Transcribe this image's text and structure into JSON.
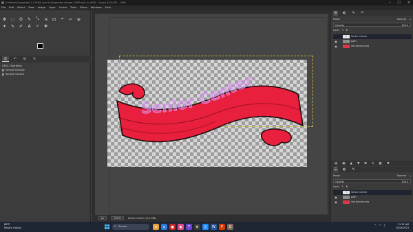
{
  "window": {
    "title": "[Untitled]-(imported)-1.0 (RGB color 8-bit gamma integer, GIMP built-in sRGB, 1 layer) 447x255 – GIMP",
    "minimize": "–",
    "maximize": "☐",
    "close": "✕"
  },
  "menu": [
    "File",
    "Edit",
    "Select",
    "View",
    "Image",
    "Layer",
    "Colors",
    "Tools",
    "Filters",
    "Windows",
    "Help"
  ],
  "toolbox": {
    "tools": [
      "✥",
      "⬚",
      "ʘ",
      "✎",
      "⤡",
      "⇲",
      "⊡",
      "⌖",
      "✂",
      "⊕",
      "✦",
      "✎",
      "✐",
      "A",
      "⌕",
      "✚"
    ],
    "tabs": [
      "☰",
      "↶",
      "⛁",
      "✎"
    ],
    "options_title": "GEGL Operation",
    "sample_average": "Sample average",
    "sample_merged": "Sample merged"
  },
  "canvas": {
    "banner_text": "Senior Center",
    "banner_color": "#e8203d",
    "text_color": "#d78cf0"
  },
  "statusbar": {
    "unit": "px",
    "zoom": "100%",
    "layer_info": "Senior Center (3.4 MB)"
  },
  "layers_panel": {
    "mode_label": "Mode",
    "mode_value": "Normal",
    "opacity_label": "Opacity",
    "opacity_value": "100.0",
    "lock_label": "Lock:",
    "layers": [
      {
        "name": "Senior Center",
        "type": "text",
        "visible": false
      },
      {
        "name": "path",
        "type": "path",
        "visible": true
      },
      {
        "name": "red-banner.png",
        "type": "png",
        "visible": true
      }
    ]
  },
  "layers_panel_2": {
    "mode_label": "Mode",
    "mode_value": "Normal",
    "opacity_label": "Opacity",
    "opacity_value": "100.0",
    "lock_label": "Lock:",
    "layers": [
      {
        "name": "Senior Center",
        "type": "text",
        "visible": false
      },
      {
        "name": "path",
        "type": "path",
        "visible": true
      },
      {
        "name": "red-banner.png",
        "type": "png",
        "visible": true
      }
    ]
  },
  "taskbar": {
    "temp": "69°F",
    "weather": "Mostly cloudy",
    "search_placeholder": "Search",
    "time": "11:22 AM",
    "date": "10/16/2023"
  }
}
